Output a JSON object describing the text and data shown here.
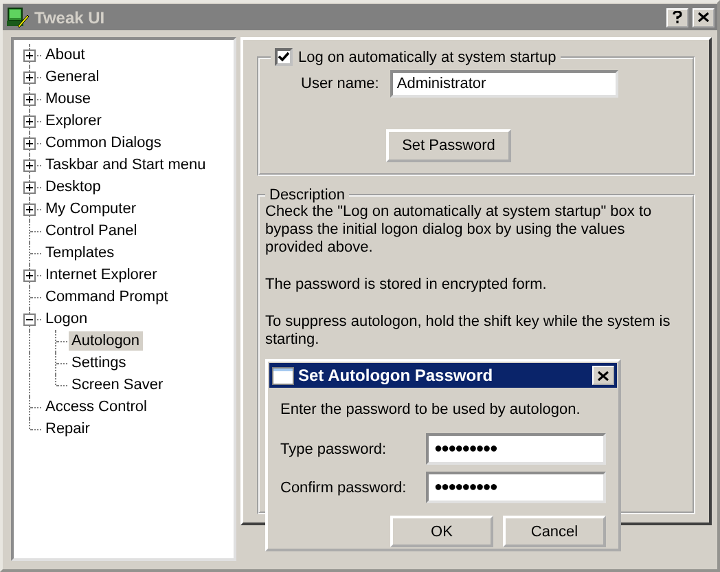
{
  "window": {
    "title": "Tweak UI"
  },
  "tree": [
    {
      "label": "About",
      "expanded": false,
      "selected": false
    },
    {
      "label": "General",
      "expanded": false,
      "selected": false
    },
    {
      "label": "Mouse",
      "expanded": false,
      "selected": false
    },
    {
      "label": "Explorer",
      "expanded": false,
      "selected": false
    },
    {
      "label": "Common Dialogs",
      "expanded": false,
      "selected": false
    },
    {
      "label": "Taskbar and Start menu",
      "expanded": false,
      "selected": false
    },
    {
      "label": "Desktop",
      "expanded": false,
      "selected": false
    },
    {
      "label": "My Computer",
      "expanded": false,
      "selected": false
    },
    {
      "label": "Control Panel",
      "selected": false
    },
    {
      "label": "Templates",
      "selected": false
    },
    {
      "label": "Internet Explorer",
      "expanded": false,
      "selected": false
    },
    {
      "label": "Command Prompt",
      "selected": false
    },
    {
      "label": "Logon",
      "expanded": true,
      "selected": false,
      "children": [
        {
          "label": "Autologon",
          "selected": true
        },
        {
          "label": "Settings",
          "selected": false
        },
        {
          "label": "Screen Saver",
          "selected": false
        }
      ]
    },
    {
      "label": "Access Control",
      "selected": false
    },
    {
      "label": "Repair",
      "selected": false
    }
  ],
  "autologon": {
    "checkbox": {
      "label": "Log on automatically at system startup",
      "checked": true
    },
    "user_name_label": "User name:",
    "user_name": "Administrator",
    "set_password_button": "Set Password"
  },
  "description": {
    "title": "Description",
    "paragraphs": [
      "Check the \"Log on automatically at system startup\" box to bypass the initial logon dialog box by using the values provided above.",
      "The password is stored in encrypted form.",
      "To suppress autologon, hold the shift key while the system is starting."
    ]
  },
  "dialog": {
    "title": "Set Autologon Password",
    "prompt": "Enter the password to be used by autologon.",
    "fields": [
      {
        "label": "Type password:",
        "value": "●●●●●●●●●"
      },
      {
        "label": "Confirm password:",
        "value": "●●●●●●●●●"
      }
    ],
    "buttons": [
      "OK",
      "Cancel"
    ]
  }
}
